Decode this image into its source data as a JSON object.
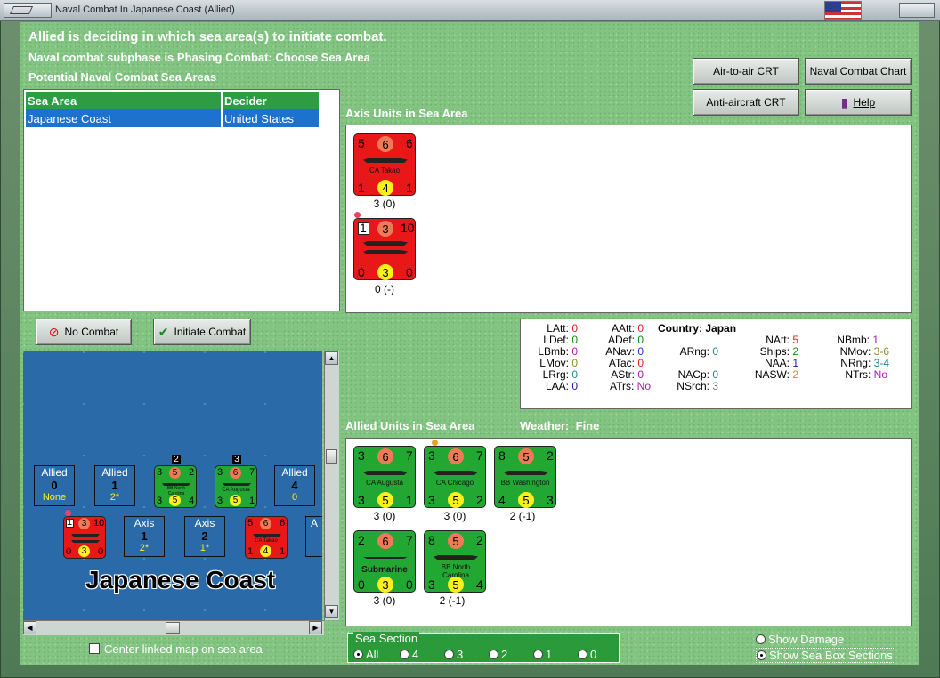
{
  "window": {
    "title": "Naval Combat In Japanese Coast (Allied)"
  },
  "header": {
    "headline": "Allied is deciding in which sea area(s) to initiate combat.",
    "subphase": "Naval combat subphase is Phasing Combat: Choose Sea Area",
    "potential": "Potential Naval Combat Sea Areas"
  },
  "buttons": {
    "air_to_air": "Air-to-air CRT",
    "naval_chart": "Naval Combat Chart",
    "anti_aircraft": "Anti-aircraft CRT",
    "help": "Help",
    "no_combat": "No Combat",
    "initiate_combat": "Initiate Combat"
  },
  "sea_table": {
    "headers": [
      "Sea Area",
      "Decider"
    ],
    "rows": [
      [
        "Japanese Coast",
        "United States"
      ]
    ]
  },
  "axis_section": {
    "label": "Axis Units in Sea Area",
    "units": [
      {
        "tl": "5",
        "mid": "6",
        "tr": "6",
        "name": "CA Takao",
        "bl": "1",
        "bmid": "4",
        "br": "1",
        "caption": "3 (0)"
      },
      {
        "tl": "1",
        "mid": "3",
        "tr": "10",
        "name": "",
        "bl": "0",
        "bmid": "3",
        "br": "0",
        "caption": "0 (-)"
      }
    ]
  },
  "stats": {
    "country_label": "Country:",
    "country": "Japan",
    "col1": [
      [
        "LAtt:",
        "0"
      ],
      [
        "LDef:",
        "0"
      ],
      [
        "LBmb:",
        "0"
      ],
      [
        "LMov:",
        "0"
      ],
      [
        "LRrg:",
        "0"
      ],
      [
        "LAA:",
        "0"
      ]
    ],
    "col2": [
      [
        "AAtt:",
        "0"
      ],
      [
        "ADef:",
        "0"
      ],
      [
        "ANav:",
        "0"
      ],
      [
        "ATac:",
        "0"
      ],
      [
        "AStr:",
        "0"
      ],
      [
        "ATrs:",
        "No"
      ]
    ],
    "col3": [
      [
        "ARng:",
        "0"
      ],
      [
        "NACp:",
        "0"
      ],
      [
        "NSrch:",
        "3"
      ]
    ],
    "col4": [
      [
        "NAtt:",
        "5"
      ],
      [
        "Ships:",
        "2"
      ],
      [
        "NAA:",
        "1"
      ],
      [
        "NASW:",
        "2"
      ]
    ],
    "col5": [
      [
        "NBmb:",
        "1"
      ],
      [
        "NMov:",
        "3-6"
      ],
      [
        "NRng:",
        "3-4"
      ],
      [
        "NTrs:",
        "No"
      ]
    ],
    "colors": {
      "red": "#e01b1b",
      "green": "#138a13",
      "magenta": "#b01ab0",
      "teal": "#1a8a8a",
      "blue": "#2a2adf",
      "navy": "#1a1a9a",
      "olive": "#8a8a1a",
      "gray": "#7a7a7a",
      "orange": "#d48a1a"
    }
  },
  "allied_section": {
    "label": "Allied Units in Sea Area",
    "weather_label": "Weather:",
    "weather": "Fine",
    "units": [
      {
        "tl": "3",
        "mid": "6",
        "tr": "7",
        "name": "CA Augusta",
        "bl": "3",
        "bmid": "5",
        "br": "1",
        "caption": "3 (0)"
      },
      {
        "tl": "3",
        "mid": "6",
        "tr": "7",
        "name": "CA Chicago",
        "bl": "3",
        "bmid": "5",
        "br": "2",
        "caption": "3 (0)"
      },
      {
        "tl": "8",
        "mid": "5",
        "tr": "2",
        "name": "BB Washington",
        "bl": "4",
        "bmid": "5",
        "br": "3",
        "caption": "2 (-1)"
      },
      {
        "tl": "2",
        "mid": "6",
        "tr": "7",
        "name": "Submarine",
        "bl": "0",
        "bmid": "3",
        "br": "0",
        "caption": "3 (0)"
      },
      {
        "tl": "8",
        "mid": "5",
        "tr": "2",
        "name": "BB North Carolina",
        "bl": "3",
        "bmid": "5",
        "br": "4",
        "caption": "2 (-1)"
      }
    ]
  },
  "map": {
    "title": "Japanese Coast",
    "boxes_top": [
      {
        "side": "Allied",
        "num": "0",
        "sub": "None"
      },
      {
        "side": "Allied",
        "num": "1",
        "sub": "2*"
      },
      {
        "side": "Allied",
        "num": "4",
        "sub": "0"
      }
    ],
    "boxes_bottom": [
      {
        "side": "Axis",
        "num": "1",
        "sub": "2*"
      },
      {
        "side": "Axis",
        "num": "2",
        "sub": "1*"
      },
      {
        "side": "A"
      }
    ],
    "stack_badges": [
      "2",
      "3"
    ],
    "mini_units": [
      {
        "tl": "3",
        "mid": "5",
        "tr": "2",
        "name": "BB North Carolina",
        "bl": "3",
        "bmid": "5",
        "br": "4"
      },
      {
        "tl": "3",
        "mid": "6",
        "tr": "7",
        "name": "CA Augusta",
        "bl": "3",
        "bmid": "5",
        "br": "1"
      },
      {
        "tl": "1",
        "mid": "3",
        "tr": "10",
        "name": "",
        "bl": "0",
        "bmid": "3",
        "br": "0"
      },
      {
        "tl": "5",
        "mid": "6",
        "tr": "6",
        "name": "CA Takao",
        "bl": "1",
        "bmid": "4",
        "br": "1"
      }
    ]
  },
  "center_map": {
    "label": "Center linked map on sea area",
    "checked": false
  },
  "sea_section": {
    "legend": "Sea Section",
    "options": [
      "All",
      "4",
      "3",
      "2",
      "1",
      "0"
    ],
    "selected": "All"
  },
  "display_options": {
    "show_damage": "Show Damage",
    "show_sections": "Show Sea Box Sections",
    "selected": "Show Sea Box Sections"
  }
}
